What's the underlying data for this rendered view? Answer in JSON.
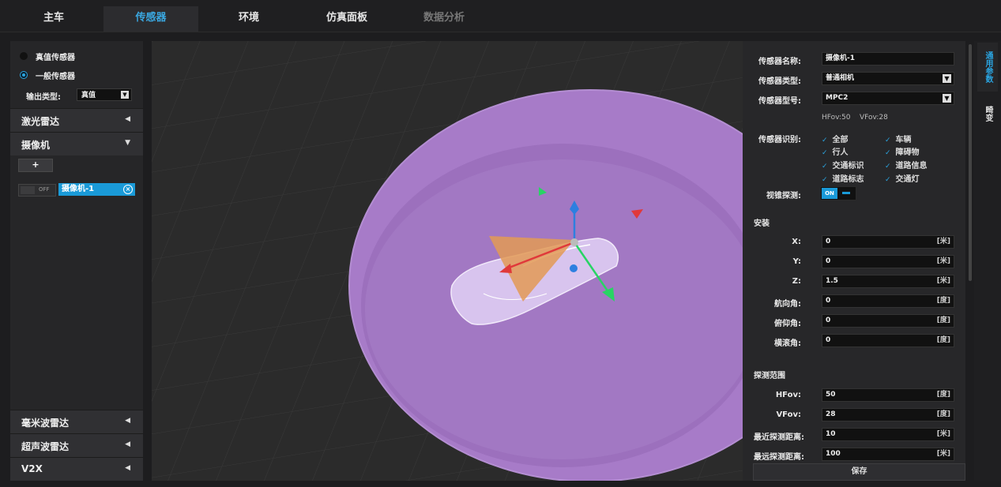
{
  "tabs": [
    "主车",
    "传感器",
    "环境",
    "仿真面板",
    "数据分析"
  ],
  "left": {
    "radio_true": "真值传感器",
    "radio_general": "一般传感器",
    "output_type_label": "输出类型:",
    "output_type_value": "真值",
    "sections_top": [
      "激光雷达",
      "摄像机"
    ],
    "add_label": "+",
    "toggle_label": "OFF",
    "sensor_chip": "摄像机-1",
    "sections_bottom": [
      "毫米波雷达",
      "超声波雷达",
      "V2X"
    ]
  },
  "right": {
    "name_label": "传感器名称:",
    "name_value": "摄像机-1",
    "type_label": "传感器类型:",
    "type_value": "普通相机",
    "model_label": "传感器型号:",
    "model_value": "MPC2",
    "hfov_info": "HFov:50",
    "vfov_info": "VFov:28",
    "recog_label": "传感器识别:",
    "recog_items": [
      "全部",
      "车辆",
      "行人",
      "障碍物",
      "交通标识",
      "道路信息",
      "道路标志",
      "交通灯"
    ],
    "cone_label": "视锥探测:",
    "cone_on": "ON",
    "install_title": "安装",
    "install_fields": [
      {
        "label": "X:",
        "value": "0",
        "unit": "[米]"
      },
      {
        "label": "Y:",
        "value": "0",
        "unit": "[米]"
      },
      {
        "label": "Z:",
        "value": "1.5",
        "unit": "[米]"
      },
      {
        "label": "航向角:",
        "value": "0",
        "unit": "[度]"
      },
      {
        "label": "俯仰角:",
        "value": "0",
        "unit": "[度]"
      },
      {
        "label": "横滚角:",
        "value": "0",
        "unit": "[度]"
      }
    ],
    "range_title": "探测范围",
    "range_fields": [
      {
        "label": "HFov:",
        "value": "50",
        "unit": "[度]"
      },
      {
        "label": "VFov:",
        "value": "28",
        "unit": "[度]"
      },
      {
        "label": "最近探测距离:",
        "value": "10",
        "unit": "[米]"
      },
      {
        "label": "最远探测距离:",
        "value": "100",
        "unit": "[米]"
      }
    ],
    "save_label": "保存"
  },
  "sidetabs": [
    "通用参数",
    "畸变"
  ],
  "colors": {
    "accent": "#2aa4e0",
    "sphere": "#a77bc8",
    "fov": "#e39a55"
  }
}
